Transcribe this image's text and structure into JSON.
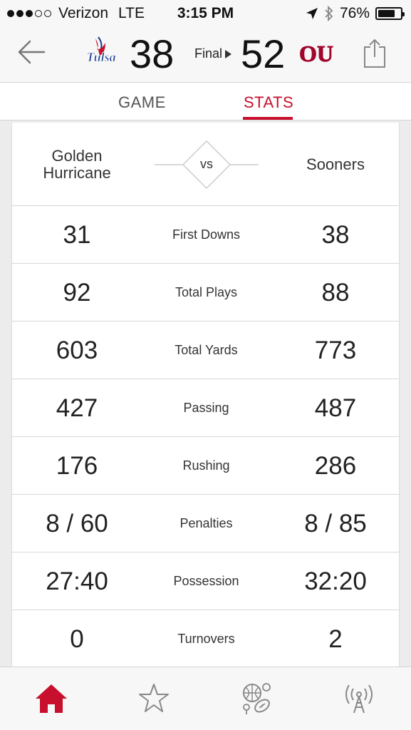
{
  "status_bar": {
    "carrier": "Verizon",
    "network": "LTE",
    "time": "3:15 PM",
    "battery": "76%",
    "battery_level": 0.76,
    "signal_bars_filled": 3,
    "signal_bars_total": 5
  },
  "header": {
    "away_team_logo": "Tulsa",
    "away_score": "38",
    "status": "Final",
    "home_score": "52",
    "home_team_logo": "OU"
  },
  "tabs": [
    {
      "label": "GAME",
      "active": false
    },
    {
      "label": "STATS",
      "active": true
    }
  ],
  "matchup": {
    "away_team": "Golden Hurricane",
    "vs": "vs",
    "home_team": "Sooners"
  },
  "stats": [
    {
      "label": "First Downs",
      "away": "31",
      "home": "38"
    },
    {
      "label": "Total Plays",
      "away": "92",
      "home": "88"
    },
    {
      "label": "Total Yards",
      "away": "603",
      "home": "773"
    },
    {
      "label": "Passing",
      "away": "427",
      "home": "487"
    },
    {
      "label": "Rushing",
      "away": "176",
      "home": "286"
    },
    {
      "label": "Penalties",
      "away": "8 / 60",
      "home": "8 / 85"
    },
    {
      "label": "Possession",
      "away": "27:40",
      "home": "32:20"
    },
    {
      "label": "Turnovers",
      "away": "0",
      "home": "2"
    }
  ],
  "colors": {
    "accent": "#c8102e",
    "tulsa_blue": "#1c3f94",
    "ou_crimson": "#a1062b"
  },
  "icons": {
    "back": "back-arrow-icon",
    "share": "share-icon",
    "home": "home-icon",
    "favorites": "star-icon",
    "sports": "sports-balls-icon",
    "live": "broadcast-icon"
  }
}
